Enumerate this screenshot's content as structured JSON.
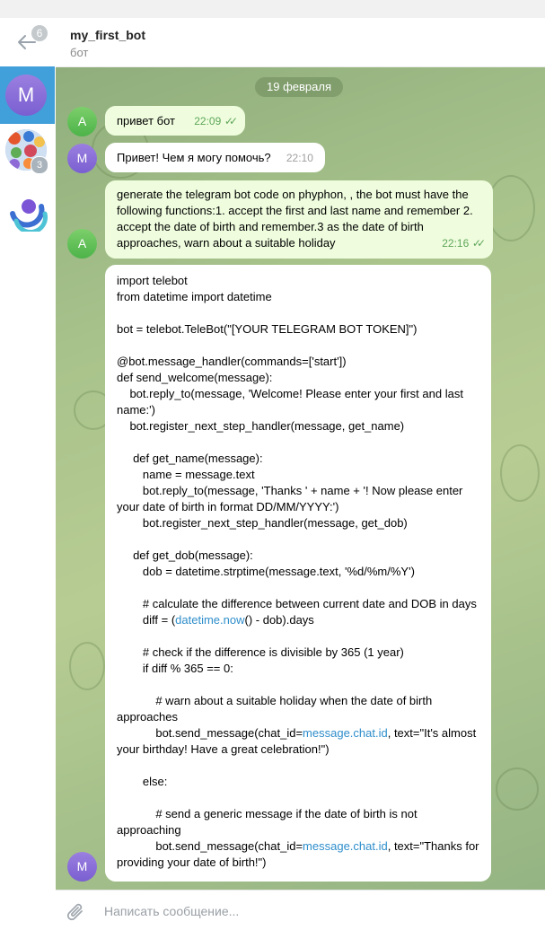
{
  "sidebar": {
    "back_badge": "6",
    "chats": [
      {
        "avatar_letter": "M",
        "active": true
      },
      {
        "avatar": "sticker-collage",
        "badge": "3"
      },
      {
        "avatar": "logo-swirl"
      }
    ]
  },
  "header": {
    "title": "my_first_bot",
    "subtitle": "бот"
  },
  "chat": {
    "date": "19 февраля",
    "messages": [
      {
        "sender": "A",
        "direction": "out",
        "text": "привет бот",
        "time": "22:09",
        "read": true
      },
      {
        "sender": "M",
        "direction": "in",
        "text": "Привет! Чем я могу помочь?",
        "time": "22:10"
      },
      {
        "sender": "A",
        "direction": "out",
        "text": "generate the telegram bot code on phyphon, , the bot must have the following functions:1. accept the first and last name and remember 2. accept the date of birth and remember.3 as the date of birth approaches, warn about a suitable holiday",
        "time": "22:16",
        "read": true
      },
      {
        "sender": "M",
        "direction": "in",
        "code_part1": "import telebot\nfrom datetime import datetime\n\nbot = telebot.TeleBot(\"[YOUR TELEGRAM BOT TOKEN]\")\n\n@bot.message_handler(commands=['start'])\ndef send_welcome(message):\n    bot.reply_to(message, 'Welcome! Please enter your first and last name:')\n    bot.register_next_step_handler(message, get_name)\n\n     def get_name(message):\n        name = message.text\n        bot.reply_to(message, 'Thanks ' + name + '! Now please enter your date of birth in format DD/MM/YYYY:')\n        bot.register_next_step_handler(message, get_dob)\n\n     def get_dob(message):\n        dob = datetime.strptime(message.text, '%d/%m/%Y')\n\n        # calculate the difference between current date and DOB in days\n        diff = (",
        "link1": "datetime.now",
        "code_part2": "() - dob).days\n\n        # check if the difference is divisible by 365 (1 year)\n        if diff % 365 == 0:\n\n            # warn about a suitable holiday when the date of birth approaches\n            bot.send_message(chat_id=",
        "link2": "message.chat.id",
        "code_part3": ", text=\"It's almost your birthday! Have a great celebration!\")\n\n        else:\n\n            # send a generic message if the date of birth is not approaching\n            bot.send_message(chat_id=",
        "link3": "message.chat.id",
        "code_part4": ", text=\"Thanks for providing your date of birth!\")"
      }
    ]
  },
  "input": {
    "placeholder": "Написать сообщение..."
  },
  "colors": {
    "accent": "#419fd9",
    "outgoing_bubble": "#effdde",
    "incoming_bubble": "#ffffff",
    "link": "#2f8ecb"
  }
}
